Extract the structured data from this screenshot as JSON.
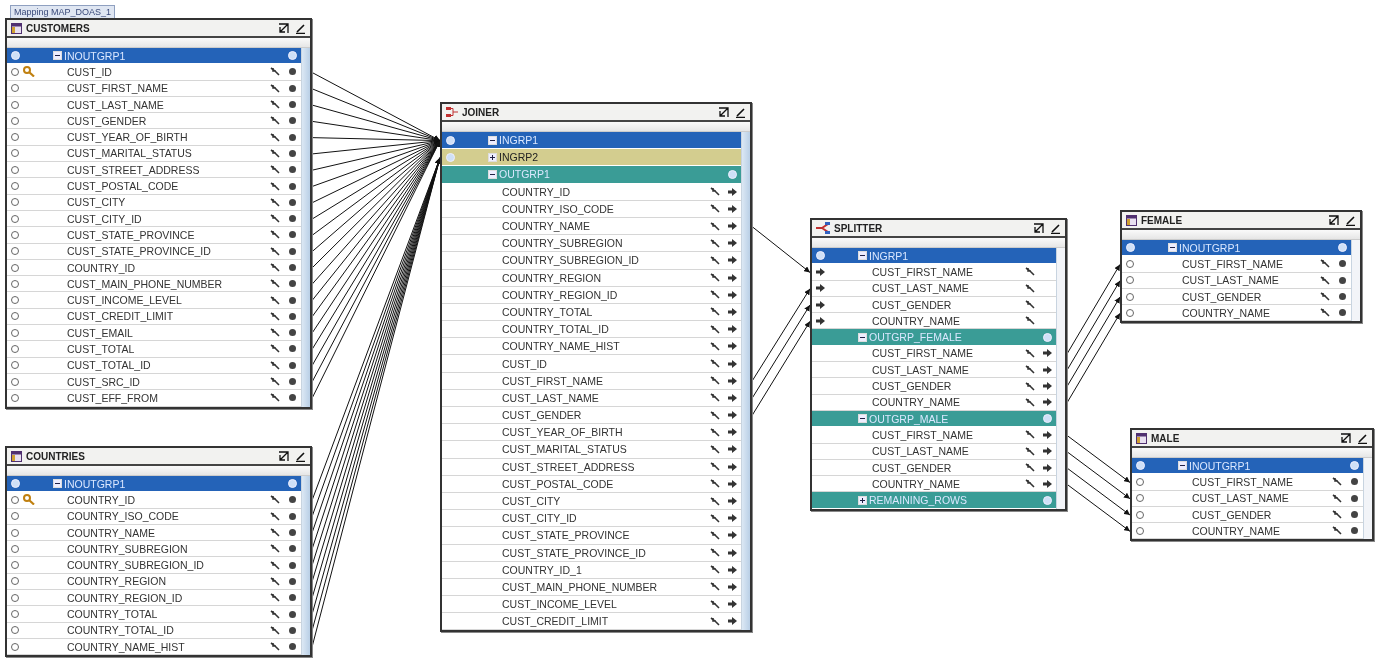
{
  "mapping_tab": {
    "label": "Mapping MAP_DOAS_1"
  },
  "operators": [
    {
      "title": "CUSTOMERS",
      "kind": "source",
      "groups": [
        {
          "label": "INOUTGRP1",
          "kind": "inout",
          "color": "#2463b8",
          "expanded": true,
          "attributes": [
            {
              "label": "CUST_ID",
              "key": true
            },
            {
              "label": "CUST_FIRST_NAME",
              "key": false
            },
            {
              "label": "CUST_LAST_NAME",
              "key": false
            },
            {
              "label": "CUST_GENDER",
              "key": false
            },
            {
              "label": "CUST_YEAR_OF_BIRTH",
              "key": false
            },
            {
              "label": "CUST_MARITAL_STATUS",
              "key": false
            },
            {
              "label": "CUST_STREET_ADDRESS",
              "key": false
            },
            {
              "label": "CUST_POSTAL_CODE",
              "key": false
            },
            {
              "label": "CUST_CITY",
              "key": false
            },
            {
              "label": "CUST_CITY_ID",
              "key": false
            },
            {
              "label": "CUST_STATE_PROVINCE",
              "key": false
            },
            {
              "label": "CUST_STATE_PROVINCE_ID",
              "key": false
            },
            {
              "label": "COUNTRY_ID",
              "key": false
            },
            {
              "label": "CUST_MAIN_PHONE_NUMBER",
              "key": false
            },
            {
              "label": "CUST_INCOME_LEVEL",
              "key": false
            },
            {
              "label": "CUST_CREDIT_LIMIT",
              "key": false
            },
            {
              "label": "CUST_EMAIL",
              "key": false
            },
            {
              "label": "CUST_TOTAL",
              "key": false
            },
            {
              "label": "CUST_TOTAL_ID",
              "key": false
            },
            {
              "label": "CUST_SRC_ID",
              "key": false
            },
            {
              "label": "CUST_EFF_FROM",
              "key": false
            }
          ]
        }
      ]
    },
    {
      "title": "COUNTRIES",
      "kind": "source",
      "groups": [
        {
          "label": "INOUTGRP1",
          "kind": "inout",
          "color": "#2463b8",
          "expanded": true,
          "attributes": [
            {
              "label": "COUNTRY_ID",
              "key": true
            },
            {
              "label": "COUNTRY_ISO_CODE",
              "key": false
            },
            {
              "label": "COUNTRY_NAME",
              "key": false
            },
            {
              "label": "COUNTRY_SUBREGION",
              "key": false
            },
            {
              "label": "COUNTRY_SUBREGION_ID",
              "key": false
            },
            {
              "label": "COUNTRY_REGION",
              "key": false
            },
            {
              "label": "COUNTRY_REGION_ID",
              "key": false
            },
            {
              "label": "COUNTRY_TOTAL",
              "key": false
            },
            {
              "label": "COUNTRY_TOTAL_ID",
              "key": false
            },
            {
              "label": "COUNTRY_NAME_HIST",
              "key": false
            }
          ]
        }
      ]
    },
    {
      "title": "JOINER",
      "kind": "joiner",
      "groups": [
        {
          "label": "INGRP1",
          "kind": "input",
          "color": "#2463b8",
          "expanded": true
        },
        {
          "label": "INGRP2",
          "kind": "input",
          "color": "#d3cd8f",
          "expanded": false
        },
        {
          "label": "OUTGRP1",
          "kind": "output",
          "color": "#3a9c96",
          "expanded": true,
          "attributes": [
            {
              "label": "COUNTRY_ID"
            },
            {
              "label": "COUNTRY_ISO_CODE"
            },
            {
              "label": "COUNTRY_NAME"
            },
            {
              "label": "COUNTRY_SUBREGION"
            },
            {
              "label": "COUNTRY_SUBREGION_ID"
            },
            {
              "label": "COUNTRY_REGION"
            },
            {
              "label": "COUNTRY_REGION_ID"
            },
            {
              "label": "COUNTRY_TOTAL"
            },
            {
              "label": "COUNTRY_TOTAL_ID"
            },
            {
              "label": "COUNTRY_NAME_HIST"
            },
            {
              "label": "CUST_ID"
            },
            {
              "label": "CUST_FIRST_NAME"
            },
            {
              "label": "CUST_LAST_NAME"
            },
            {
              "label": "CUST_GENDER"
            },
            {
              "label": "CUST_YEAR_OF_BIRTH"
            },
            {
              "label": "CUST_MARITAL_STATUS"
            },
            {
              "label": "CUST_STREET_ADDRESS"
            },
            {
              "label": "CUST_POSTAL_CODE"
            },
            {
              "label": "CUST_CITY"
            },
            {
              "label": "CUST_CITY_ID"
            },
            {
              "label": "CUST_STATE_PROVINCE"
            },
            {
              "label": "CUST_STATE_PROVINCE_ID"
            },
            {
              "label": "COUNTRY_ID_1"
            },
            {
              "label": "CUST_MAIN_PHONE_NUMBER"
            },
            {
              "label": "CUST_INCOME_LEVEL"
            },
            {
              "label": "CUST_CREDIT_LIMIT"
            }
          ]
        }
      ]
    },
    {
      "title": "SPLITTER",
      "kind": "splitter",
      "groups": [
        {
          "label": "INGRP1",
          "kind": "input",
          "color": "#2463b8",
          "expanded": true,
          "attributes": [
            {
              "label": "CUST_FIRST_NAME"
            },
            {
              "label": "CUST_LAST_NAME"
            },
            {
              "label": "CUST_GENDER"
            },
            {
              "label": "COUNTRY_NAME"
            }
          ]
        },
        {
          "label": "OUTGRP_FEMALE",
          "kind": "output",
          "color": "#3a9c96",
          "expanded": true,
          "attributes": [
            {
              "label": "CUST_FIRST_NAME"
            },
            {
              "label": "CUST_LAST_NAME"
            },
            {
              "label": "CUST_GENDER"
            },
            {
              "label": "COUNTRY_NAME"
            }
          ]
        },
        {
          "label": "OUTGRP_MALE",
          "kind": "output",
          "color": "#3a9c96",
          "expanded": true,
          "attributes": [
            {
              "label": "CUST_FIRST_NAME"
            },
            {
              "label": "CUST_LAST_NAME"
            },
            {
              "label": "CUST_GENDER"
            },
            {
              "label": "COUNTRY_NAME"
            }
          ]
        },
        {
          "label": "REMAINING_ROWS",
          "kind": "output",
          "color": "#3a9c96",
          "expanded": false
        }
      ]
    },
    {
      "title": "FEMALE",
      "kind": "target",
      "groups": [
        {
          "label": "INOUTGRP1",
          "kind": "inout",
          "color": "#2463b8",
          "expanded": true,
          "attributes": [
            {
              "label": "CUST_FIRST_NAME"
            },
            {
              "label": "CUST_LAST_NAME"
            },
            {
              "label": "CUST_GENDER"
            },
            {
              "label": "COUNTRY_NAME"
            }
          ]
        }
      ]
    },
    {
      "title": "MALE",
      "kind": "target",
      "groups": [
        {
          "label": "INOUTGRP1",
          "kind": "inout",
          "color": "#2463b8",
          "expanded": true,
          "attributes": [
            {
              "label": "CUST_FIRST_NAME"
            },
            {
              "label": "CUST_LAST_NAME"
            },
            {
              "label": "CUST_GENDER"
            },
            {
              "label": "COUNTRY_NAME"
            }
          ]
        }
      ]
    }
  ]
}
